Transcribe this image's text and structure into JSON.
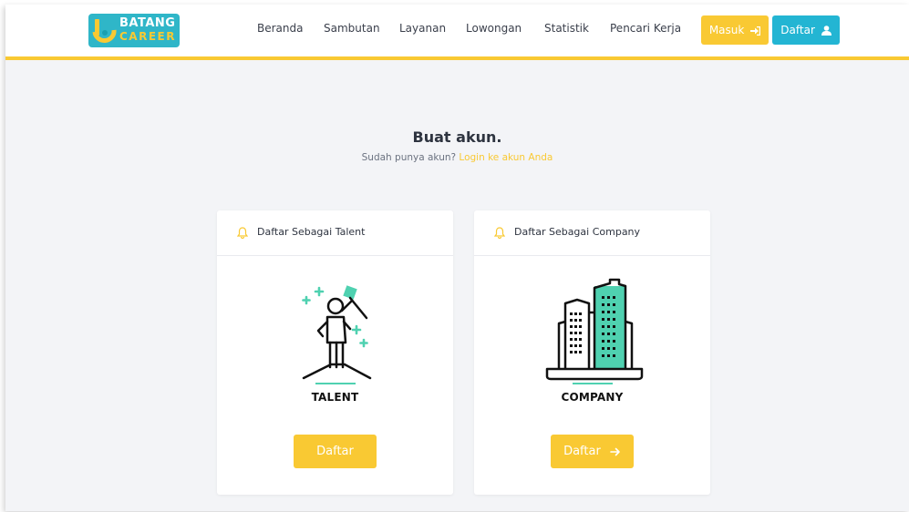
{
  "brand": {
    "line1": "BATANG",
    "line2": "CAREER",
    "colors": {
      "teal": "#2fb6c8",
      "yellow": "#f9c933",
      "cyan": "#23b5d3"
    }
  },
  "nav": {
    "links": [
      "Beranda",
      "Sambutan",
      "Layanan",
      "Lowongan",
      "Statistik",
      "Pencari Kerja"
    ],
    "masuk_label": "Masuk",
    "masuk_icon": "sign-in-icon",
    "daftar_label": "Daftar",
    "daftar_icon": "user-icon"
  },
  "header": {
    "title": "Buat akun.",
    "subtitle_text": "Sudah punya akun?",
    "login_link": "Login ke akun Anda"
  },
  "cards": [
    {
      "heading": "Daftar Sebagai Talent",
      "heading_icon": "bell-icon",
      "illustration": "talent-illustration",
      "label": "TALENT",
      "button_label": "Daftar"
    },
    {
      "heading": "Daftar Sebagai Company",
      "heading_icon": "bell-icon",
      "illustration": "company-illustration",
      "label": "COMPANY",
      "button_label": "Daftar",
      "button_icon": "arrow-right-icon"
    }
  ]
}
